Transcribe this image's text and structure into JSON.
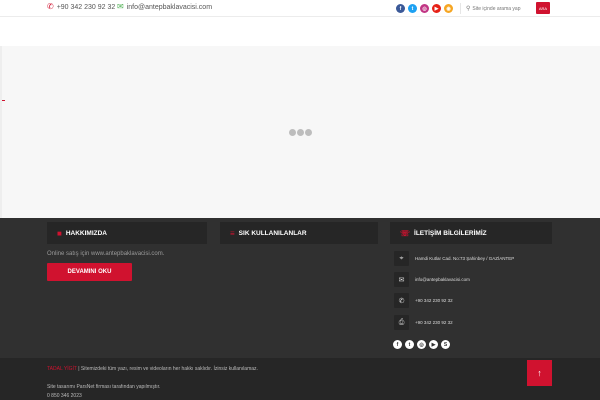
{
  "topbar": {
    "phone": "+90 342 230 92 32",
    "email": "info@antepbaklavacisi.com",
    "social": [
      {
        "icon": "facebook-icon",
        "glyph": "f",
        "color": "#3b5998"
      },
      {
        "icon": "twitter-icon",
        "glyph": "t",
        "color": "#1da1f2"
      },
      {
        "icon": "instagram-icon",
        "glyph": "◎",
        "color": "#c13584"
      },
      {
        "icon": "youtube-icon",
        "glyph": "▶",
        "color": "#e62117"
      },
      {
        "icon": "rss-icon",
        "glyph": "◉",
        "color": "#f6a623"
      }
    ],
    "search_placeholder": "Site içinde arama yap",
    "search_button": "ARA"
  },
  "footer": {
    "about": {
      "title": "HAKKIMIZDA",
      "text": "Online satış için www.antepbaklavacisi.com.",
      "button": "DEVAMINI OKU"
    },
    "links": {
      "title": "SIK KULLANILANLAR"
    },
    "contact": {
      "title": "İLETİŞİM BİLGİLERİMİZ",
      "address": "Hamdi Kutlar Cad. No:73 Şahinbey / GAZİANTEP",
      "email": "info@antepbaklavacisi.com",
      "phone": "+90 342 230 92 32",
      "fax": "+90 342 230 92 32"
    },
    "social": [
      {
        "icon": "facebook-icon",
        "glyph": "f"
      },
      {
        "icon": "twitter-icon",
        "glyph": "t"
      },
      {
        "icon": "instagram-icon",
        "glyph": "◎"
      },
      {
        "icon": "youtube-icon",
        "glyph": "▶"
      },
      {
        "icon": "skype-icon",
        "glyph": "S"
      }
    ]
  },
  "bottom": {
    "brand": "TADAL YİGİT",
    "copyright": " | Sitemizdeki tüm yazı, resim ve videoların her hakkı saklıdır. İzinsiz kullanılamaz.",
    "design": "Site tasarımı ParsNet firması tarafından yapılmıştır.",
    "tel": "0 850 346 2023",
    "to_top": "↑"
  },
  "colors": {
    "accent": "#d0122f",
    "footer_bg": "#303030",
    "footer_dark": "#262626"
  }
}
